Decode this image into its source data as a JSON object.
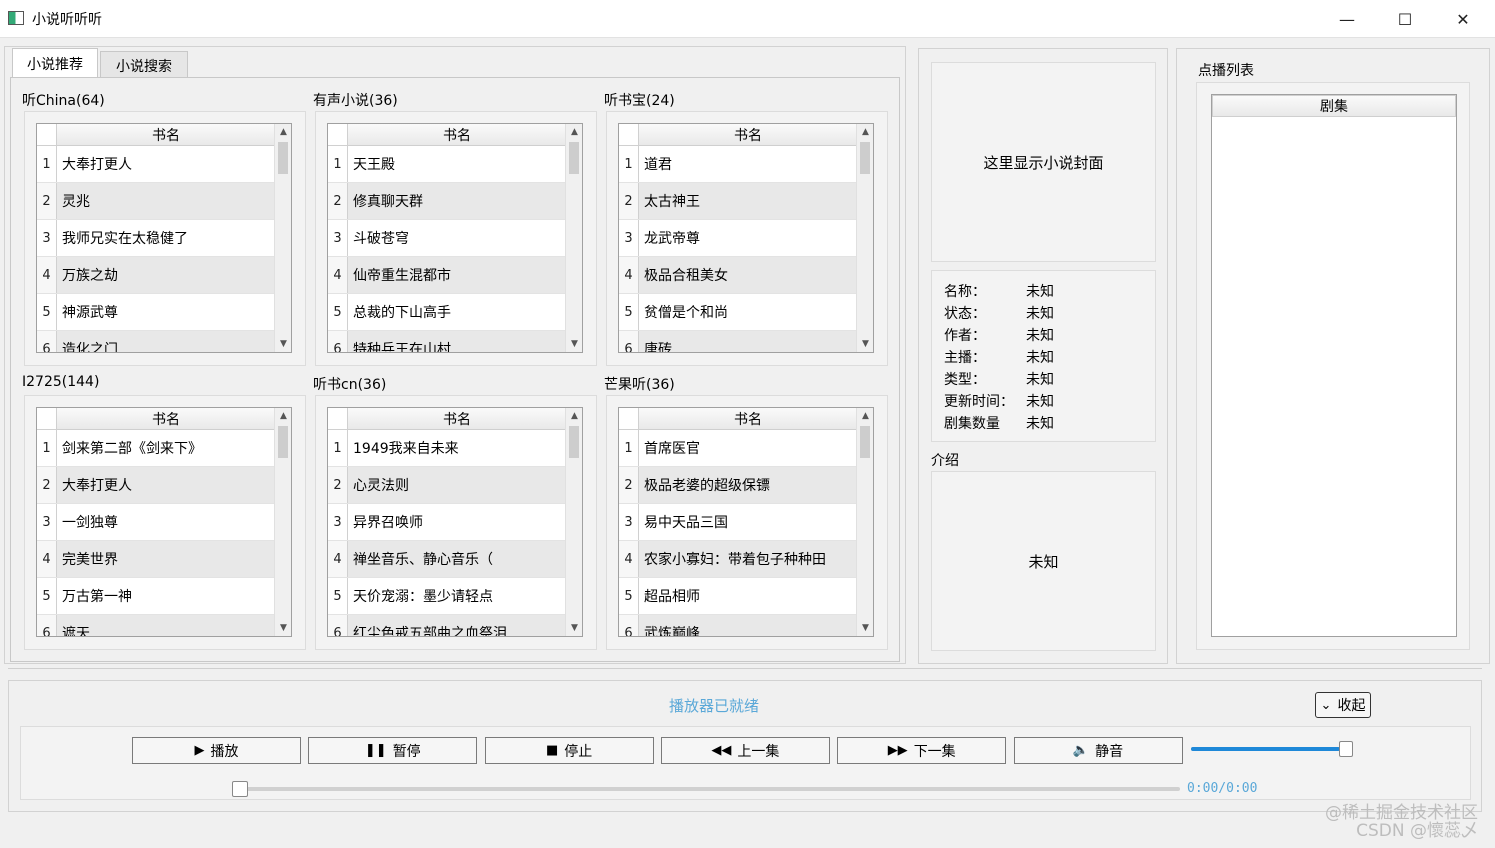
{
  "window": {
    "title": "小说听听听",
    "minimize": "—",
    "maximize": "☐",
    "close": "✕"
  },
  "tabs": [
    {
      "label": "小说推荐",
      "active": true
    },
    {
      "label": "小说搜索",
      "active": false
    }
  ],
  "column_header": "书名",
  "sources": [
    {
      "title": "听China(64)",
      "books": [
        "大奉打更人",
        "灵兆",
        "我师兄实在太稳健了",
        "万族之劫",
        "神源武尊",
        "造化之门"
      ]
    },
    {
      "title": "有声小说(36)",
      "books": [
        "天王殿",
        "修真聊天群",
        "斗破苍穹",
        "仙帝重生混都市",
        "总裁的下山高手",
        "特种兵王在山村"
      ]
    },
    {
      "title": "听书宝(24)",
      "books": [
        "道君",
        "太古神王",
        "龙武帝尊",
        "极品合租美女",
        "贫僧是个和尚",
        "唐砖"
      ]
    },
    {
      "title": "I2725(144)",
      "books": [
        "剑来第二部《剑来下》",
        "大奉打更人",
        "一剑独尊",
        "完美世界",
        "万古第一神",
        "遮天"
      ]
    },
    {
      "title": "听书cn(36)",
      "books": [
        "1949我来自未来",
        "心灵法则",
        "异界召唤师",
        "禅坐音乐、静心音乐（",
        "天价宠溺：墨少请轻点",
        "红尘色戒五部曲之血祭泪"
      ]
    },
    {
      "title": "芒果听(36)",
      "books": [
        "首席医官",
        "极品老婆的超级保镖",
        "易中天品三国",
        "农家小寡妇：带着包子种种田",
        "超品相师",
        "武炼巅峰"
      ]
    }
  ],
  "cover": {
    "placeholder": "这里显示小说封面"
  },
  "info": [
    {
      "key": "名称：",
      "value": "未知"
    },
    {
      "key": "状态：",
      "value": "未知"
    },
    {
      "key": "作者：",
      "value": "未知"
    },
    {
      "key": "主播：",
      "value": "未知"
    },
    {
      "key": "类型：",
      "value": "未知"
    },
    {
      "key": "更新时间：",
      "value": "未知"
    },
    {
      "key": "剧集数量",
      "value": "未知"
    }
  ],
  "intro": {
    "label": "介绍",
    "text": "未知"
  },
  "playlist": {
    "title": "点播列表",
    "header": "剧集"
  },
  "player": {
    "status": "播放器已就绪",
    "collapse_label": "收起",
    "buttons": [
      {
        "icon": "▶",
        "label": "播放"
      },
      {
        "icon": "❚❚",
        "label": "暂停"
      },
      {
        "icon": "■",
        "label": "停止"
      },
      {
        "icon": "◀◀",
        "label": "上一集"
      },
      {
        "icon": "▶▶",
        "label": "下一集"
      },
      {
        "icon": "🔈",
        "label": "静音"
      }
    ],
    "volume": 0.93,
    "progress": 0,
    "time": "0:00/0:00"
  },
  "watermark": {
    "line1": "@稀土掘金技术社区",
    "line2": "CSDN @懷蕊乄"
  },
  "colors": {
    "status": "#5aa8d8",
    "volume_fill": "#1e88d8"
  }
}
